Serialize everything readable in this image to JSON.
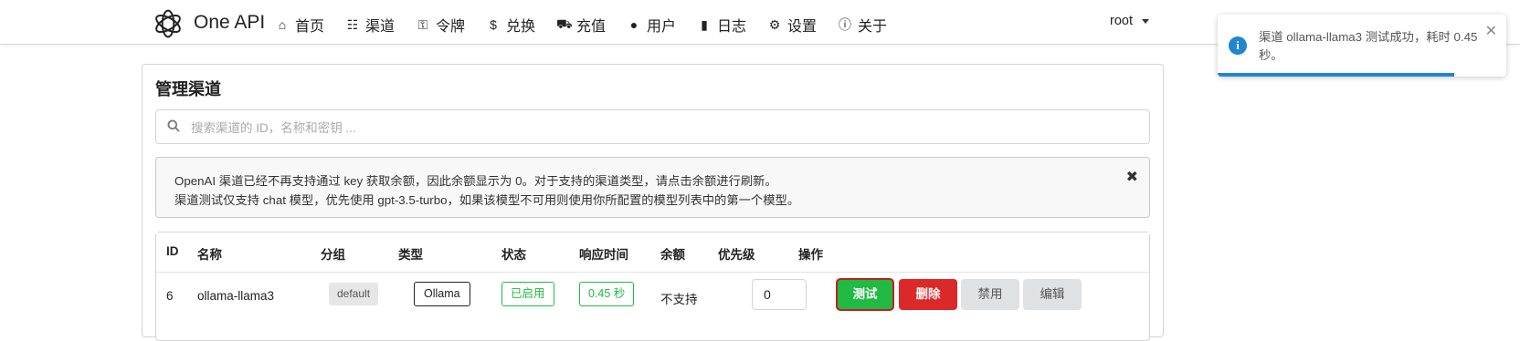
{
  "brand": {
    "name": "One API"
  },
  "nav": [
    {
      "icon": "home-icon",
      "glyph": "⌂",
      "label": "首页"
    },
    {
      "icon": "sitemap-icon",
      "glyph": "☷",
      "label": "渠道"
    },
    {
      "icon": "key-icon",
      "glyph": "⚿",
      "label": "令牌"
    },
    {
      "icon": "dollar-icon",
      "glyph": "$",
      "label": "兑换"
    },
    {
      "icon": "cart-icon",
      "glyph": "⛟",
      "label": "充值"
    },
    {
      "icon": "user-icon",
      "glyph": "●",
      "label": "用户"
    },
    {
      "icon": "book-icon",
      "glyph": "▮",
      "label": "日志"
    },
    {
      "icon": "gear-icon",
      "glyph": "⚙",
      "label": "设置"
    },
    {
      "icon": "info-icon",
      "glyph": "ⓘ",
      "label": "关于"
    }
  ],
  "user_menu": {
    "label": "root"
  },
  "page": {
    "title": "管理渠道"
  },
  "search": {
    "placeholder": "搜索渠道的 ID，名称和密钥 ..."
  },
  "notice": {
    "line1": "OpenAI 渠道已经不再支持通过 key 获取余额，因此余额显示为 0。对于支持的渠道类型，请点击余额进行刷新。",
    "line2": "渠道测试仅支持 chat 模型，优先使用 gpt-3.5-turbo，如果该模型不可用则使用你所配置的模型列表中的第一个模型。",
    "close": "✖"
  },
  "table": {
    "headers": [
      "ID",
      "名称",
      "分组",
      "类型",
      "状态",
      "响应时间",
      "余额",
      "优先级",
      "操作"
    ],
    "rows": [
      {
        "id": "6",
        "name": "ollama-llama3",
        "group": "default",
        "type": "Ollama",
        "status": "已启用",
        "response_time": "0.45 秒",
        "balance": "不支持",
        "priority": "0",
        "actions": {
          "test": "测试",
          "delete": "删除",
          "disable": "禁用",
          "edit": "编辑"
        }
      }
    ]
  },
  "toast": {
    "message": "渠道 ollama-llama3 测试成功，耗时 0.45 秒。",
    "progress": 0.82,
    "icon": "i",
    "close": "✕"
  },
  "colors": {
    "accent": "#2185d0",
    "success": "#21ba45",
    "danger": "#db2828",
    "neutral_button": "#e0e1e2"
  }
}
